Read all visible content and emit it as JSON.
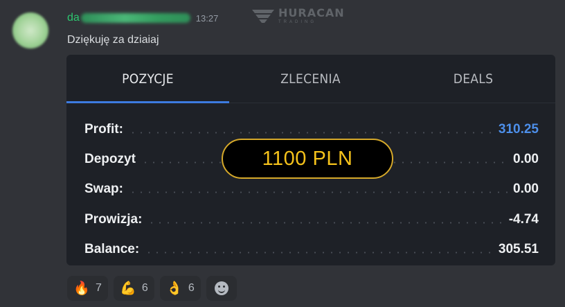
{
  "message": {
    "username_visible": "da",
    "timestamp": "13:27",
    "text": "Dziękuję za dziaiaj"
  },
  "brand": {
    "name": "HURACAN",
    "subtitle": "TRADING"
  },
  "card": {
    "tabs": [
      {
        "label": "POZYCJE",
        "active": true
      },
      {
        "label": "ZLECENIA",
        "active": false
      },
      {
        "label": "DEALS",
        "active": false
      }
    ],
    "rows": [
      {
        "label": "Profit:",
        "value": "310.25",
        "highlight": true
      },
      {
        "label": "Depozyt",
        "value": "0.00",
        "highlight": false
      },
      {
        "label": "Swap:",
        "value": "0.00",
        "highlight": false
      },
      {
        "label": "Prowizja:",
        "value": "-4.74",
        "highlight": false
      },
      {
        "label": "Balance:",
        "value": "305.51",
        "highlight": false
      }
    ],
    "overlay": "1100 PLN"
  },
  "reactions": [
    {
      "icon": "fire-icon",
      "emoji": "🔥",
      "count": "7"
    },
    {
      "icon": "flexed-biceps-icon",
      "emoji": "💪",
      "count": "6"
    },
    {
      "icon": "ok-hand-icon",
      "emoji": "👌",
      "count": "6"
    }
  ],
  "colors": {
    "background": "#313338",
    "card": "#1e2127",
    "username": "#2dc770",
    "tab_underline": "#3d7be0",
    "profit": "#4d8fea",
    "overlay_text": "#f5c21b"
  }
}
